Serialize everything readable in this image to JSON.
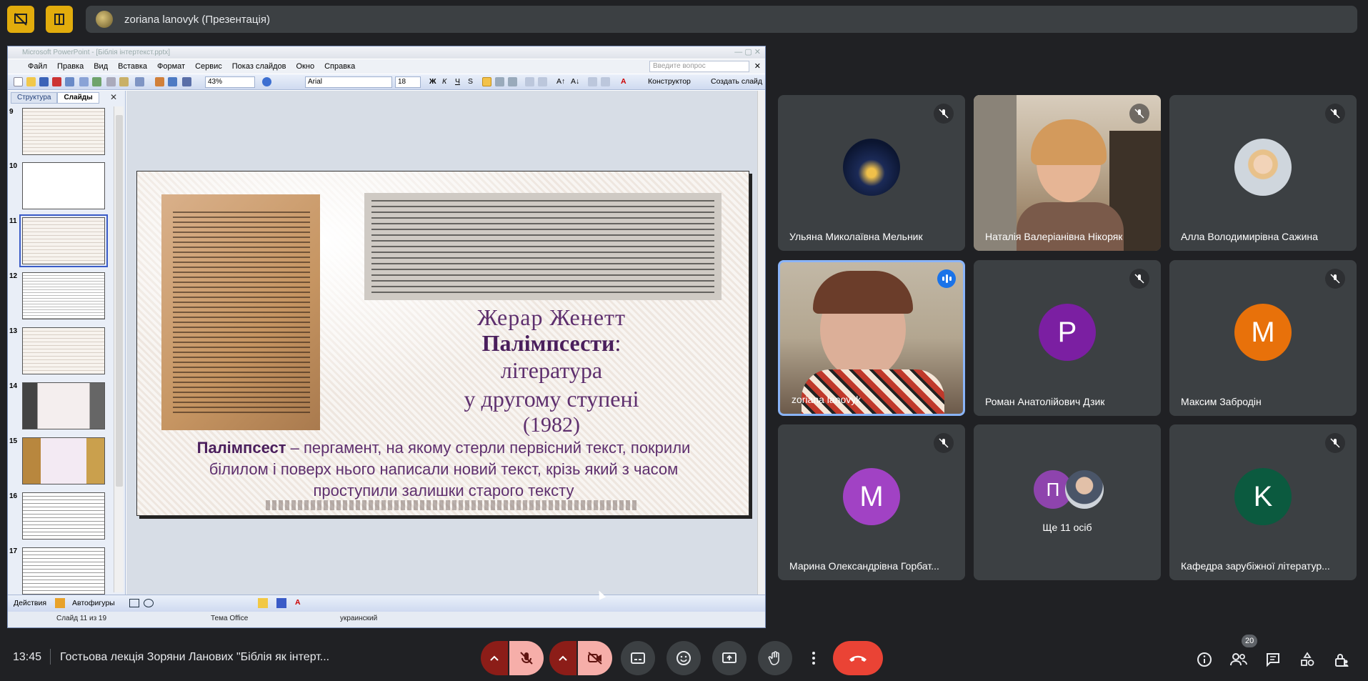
{
  "presenter": {
    "name": "zoriana lanovyk (Презентація)"
  },
  "powerpoint": {
    "title": "Microsoft PowerPoint - [Біблія інтертекст.pptx]",
    "menu": [
      "Файл",
      "Правка",
      "Вид",
      "Вставка",
      "Формат",
      "Сервис",
      "Показ слайдов",
      "Окно",
      "Справка"
    ],
    "ask_placeholder": "Введите вопрос",
    "zoom": "43%",
    "font": "Arial",
    "font_size": "18",
    "designer_label": "Конструктор",
    "new_slide_label": "Создать слайд",
    "tabs": [
      "Структура",
      "Слайды"
    ],
    "thumbnails": [
      "9",
      "10",
      "11",
      "12",
      "13",
      "14",
      "15",
      "16",
      "17"
    ],
    "selected_slide": "11",
    "draw_actions": "Действия",
    "autoshapes": "Автофигуры",
    "status": {
      "slide": "Слайд 11 из 19",
      "theme": "Тема Office",
      "language": "украинский"
    },
    "slide": {
      "author": "Жерар Женетт",
      "title": "Палімпсести",
      "title_colon": ":",
      "subtitle1": "література",
      "subtitle2": "у другому ступені",
      "year": "(1982)",
      "def_term": "Палімпсест",
      "def_rest": " – пергамент, на якому стерли первісний текст, покрили білилом і поверх нього написали новий текст, крізь який з часом проступили залишки старого тексту"
    }
  },
  "participants": [
    {
      "name": "Ульяна Миколаївна Мельник",
      "type": "photo",
      "muted": true
    },
    {
      "name": "Наталія Валеріанівна Нікоряк",
      "type": "video",
      "muted": true
    },
    {
      "name": "Алла Володимирівна Сажина",
      "type": "photo",
      "muted": true
    },
    {
      "name": "zoriana lanovyk",
      "type": "video",
      "speaking": true
    },
    {
      "name": "Роман Анатолійович Дзик",
      "letter": "P",
      "color": "#7b1fa2",
      "muted": true
    },
    {
      "name": "Максим Забродін",
      "letter": "M",
      "color": "#e8710a",
      "muted": true
    },
    {
      "name": "Марина Олександрівна Горбат...",
      "letter": "M",
      "color": "#a142c4",
      "muted": true
    },
    {
      "name": "Ще 11 осіб",
      "letter": "П",
      "color": "#8e44ad"
    },
    {
      "name": "Кафедра зарубіжної літератур...",
      "letter": "K",
      "color": "#0b5a3f",
      "muted": true
    }
  ],
  "meeting": {
    "time": "13:45",
    "title": "Гостьова лекція Зоряни Ланових \"Біблія як інтерт...",
    "participants_count": "20"
  },
  "colors": {
    "accent_yellow": "#e2ac0c",
    "end_call": "#ea4335",
    "mic_off": "#8c1d18"
  }
}
